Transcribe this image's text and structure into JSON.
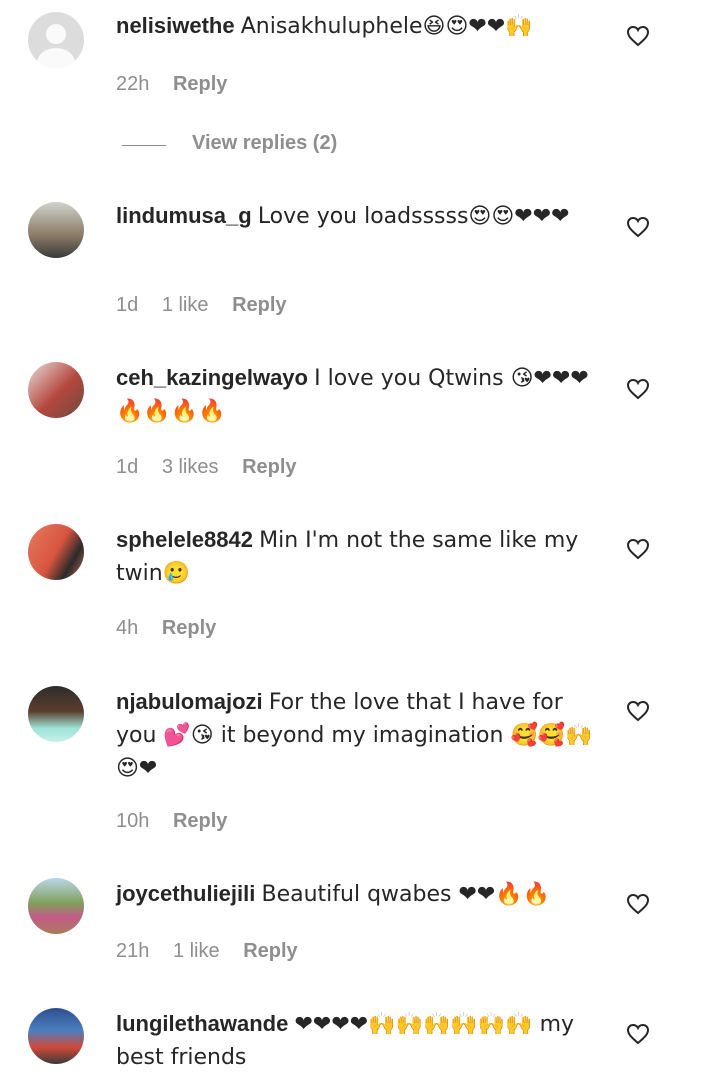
{
  "heart_color": "#262626",
  "comments": [
    {
      "user": "nelisiwethe",
      "text": "Anisakhuluphele😆😍❤❤🙌",
      "time": "22h",
      "likes": "",
      "reply": "Reply",
      "view_replies": "View replies (2)"
    },
    {
      "user": "lindumusa_g",
      "text": "Love you loadsssss😍😍❤❤❤",
      "time": "1d",
      "likes": "1 like",
      "reply": "Reply"
    },
    {
      "user": "ceh_kazingelwayo",
      "text": "I love you Qtwins 😘❤❤❤🔥🔥🔥🔥",
      "time": "1d",
      "likes": "3 likes",
      "reply": "Reply"
    },
    {
      "user": "sphelele8842",
      "text": "Min I'm not the same like my twin🥲",
      "time": "4h",
      "likes": "",
      "reply": "Reply"
    },
    {
      "user": "njabulomajozi",
      "text": "For the love that I have for you 💕😘 it beyond my imagination 🥰🥰🙌😍❤",
      "time": "10h",
      "likes": "",
      "reply": "Reply"
    },
    {
      "user": "joycethuliejili",
      "text": "Beautiful qwabes ❤❤🔥🔥",
      "time": "21h",
      "likes": "1 like",
      "reply": "Reply"
    },
    {
      "user": "lungilethawande",
      "text": "❤❤❤❤🙌🙌🙌🙌🙌🙌 my best friends",
      "time": "",
      "likes": "",
      "reply": ""
    }
  ]
}
